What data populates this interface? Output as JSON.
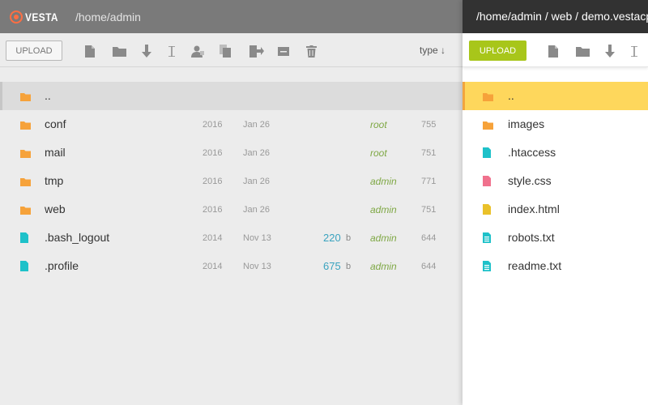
{
  "left_pane": {
    "logo_text": "VESTA",
    "path": "/home/admin",
    "upload_label": "UPLOAD",
    "sort_label": "type ↓",
    "files": [
      {
        "name": "..",
        "type": "folder",
        "year": "",
        "date": "",
        "size": "",
        "unit": "",
        "owner": "",
        "perm": ""
      },
      {
        "name": "conf",
        "type": "folder",
        "year": "2016",
        "date": "Jan 26",
        "size": "",
        "unit": "",
        "owner": "root",
        "perm": "755"
      },
      {
        "name": "mail",
        "type": "folder",
        "year": "2016",
        "date": "Jan 26",
        "size": "",
        "unit": "",
        "owner": "root",
        "perm": "751"
      },
      {
        "name": "tmp",
        "type": "folder",
        "year": "2016",
        "date": "Jan 26",
        "size": "",
        "unit": "",
        "owner": "admin",
        "perm": "771"
      },
      {
        "name": "web",
        "type": "folder",
        "year": "2016",
        "date": "Jan 26",
        "size": "",
        "unit": "",
        "owner": "admin",
        "perm": "751"
      },
      {
        "name": ".bash_logout",
        "type": "file",
        "year": "2014",
        "date": "Nov 13",
        "size": "220",
        "unit": "b",
        "owner": "admin",
        "perm": "644"
      },
      {
        "name": ".profile",
        "type": "file",
        "year": "2014",
        "date": "Nov 13",
        "size": "675",
        "unit": "b",
        "owner": "admin",
        "perm": "644"
      }
    ]
  },
  "right_pane": {
    "path": "/home/admin / web / demo.vestacp.com",
    "upload_label": "UPLOAD",
    "files": [
      {
        "name": "..",
        "type": "folder"
      },
      {
        "name": "images",
        "type": "folder"
      },
      {
        "name": ".htaccess",
        "type": "file-teal"
      },
      {
        "name": "style.css",
        "type": "file-pink"
      },
      {
        "name": "index.html",
        "type": "file-yellow"
      },
      {
        "name": "robots.txt",
        "type": "text-teal"
      },
      {
        "name": "readme.txt",
        "type": "text-teal"
      }
    ]
  },
  "colors": {
    "folder": "#f6a23a",
    "teal": "#1ec1c9",
    "pink": "#f0718d",
    "yellow": "#eac12a",
    "upload_active": "#a8c61a",
    "selected_right": "#fed75c"
  }
}
